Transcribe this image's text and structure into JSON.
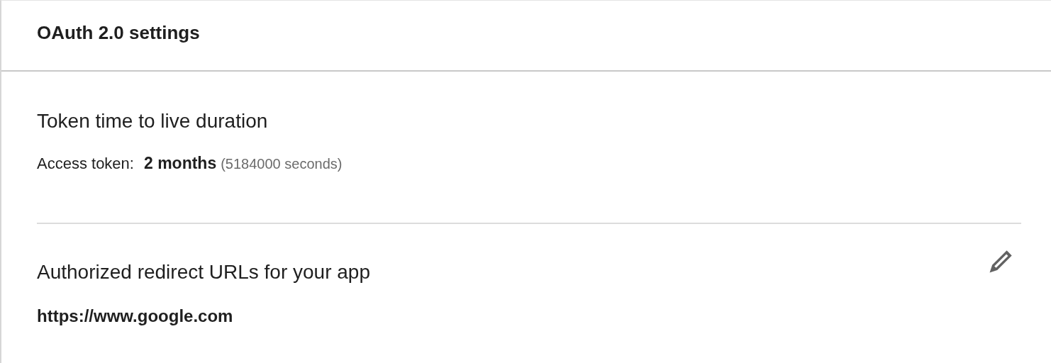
{
  "header": {
    "title": "OAuth 2.0 settings"
  },
  "sections": [
    {
      "kind": "duration",
      "heading": "Token time to live duration",
      "label": "Access token:",
      "value": "2 months",
      "detail": "(5184000 seconds)"
    },
    {
      "kind": "urls",
      "heading": "Authorized redirect URLs for your app",
      "editable": true,
      "urls": [
        "https://www.google.com"
      ]
    }
  ]
}
